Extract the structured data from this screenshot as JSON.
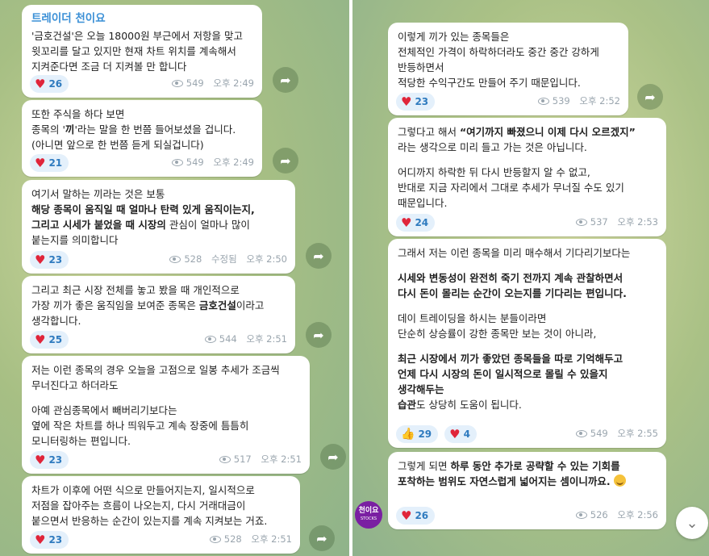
{
  "left": {
    "messages": [
      {
        "sender": "트레이더 천이요",
        "lines": [
          "'금호건설'은 오늘 18000원 부근에서 저항을 맞고",
          "윗꼬리를 달고 있지만 현재 차트 위치를 계속해서",
          "지켜준다면 조금 더 지켜볼 만 합니다"
        ],
        "reaction": "26",
        "views": "549",
        "time": "오후 2:49"
      },
      {
        "l1": "또한 주식을 하다 보면",
        "l2a": "종목의 '",
        "l2b": "끼",
        "l2c": "'라는 말을 한 번쯤 들어보셨을 겁니다.",
        "l3": "(아니면 앞으로 한 번쯤 듣게 되실겁니다)",
        "reaction": "21",
        "views": "549",
        "time": "오후 2:49"
      },
      {
        "l1": "여기서 말하는 끼라는 것은 보통",
        "b1": "해당 종목이 움직일 때 얼마나 탄력 있게 움직이는지,",
        "b2": "그리고 시세가 붙었을 때 시장의",
        "t2": " 관심이 얼마나 많이",
        "l4": "붙는지를 의미합니다",
        "reaction": "23",
        "views": "528",
        "edited": "수정됨",
        "time": "오후 2:50"
      },
      {
        "l1": "그리고 최근 시장 전체를 놓고 봤을 때 개인적으로",
        "l2a": "가장 끼가 좋은 움직임을 보여준 종목은 ",
        "l2b": "금호건설",
        "l2c": "이라고",
        "l3": "생각합니다.",
        "reaction": "25",
        "views": "544",
        "time": "오후 2:51"
      },
      {
        "p1": [
          "저는 이런 종목의 경우 오늘을 고점으로 일봉 추세가 조금씩",
          "무너진다고 하더라도"
        ],
        "p2": [
          "아예 관심종목에서 빼버리기보다는",
          "옆에 작은 차트를 하나 띄워두고 계속 장중에 틈틈히",
          "모니터링하는 편입니다."
        ],
        "reaction": "23",
        "views": "517",
        "time": "오후 2:51"
      },
      {
        "lines": [
          "차트가 이후에 어떤 식으로 만들어지는지, 일시적으로",
          "저점을 잡아주는 흐름이 나오는지, 다시 거래대금이",
          "붙으면서 반응하는 순간이 있는지를 계속 지켜보는 거죠."
        ],
        "reaction": "23",
        "views": "528",
        "time": "오후 2:51"
      }
    ]
  },
  "right": {
    "messages": [
      {
        "lines": [
          "이렇게 끼가 있는 종목들은",
          "전체적인 가격이 하락하더라도 중간 중간 강하게",
          "반등하면서",
          "적당한 수익구간도 만들어 주기 때문입니다."
        ],
        "reaction": "23",
        "views": "539",
        "time": "오후 2:52"
      },
      {
        "l1a": "그렇다고 해서 ",
        "l1b": "“여기까지 빠졌으니 이제 다시 오르겠지”",
        "l2": "라는 생각으로 미리 들고 가는 것은 아닙니다.",
        "p2": [
          "어디까지 하락한 뒤 다시 반등할지 알 수 없고,",
          "반대로 지금 자리에서 그대로 추세가 무너질 수도 있기",
          "때문입니다."
        ],
        "reaction": "24",
        "views": "537",
        "time": "오후 2:53"
      },
      {
        "l1": "그래서 저는 이런 종목을 미리 매수해서 기다리기보다는",
        "b1": [
          "시세와 변동성이 완전히 죽기 전까지 계속 관찰하면서",
          "다시 돈이 몰리는 순간이 오는지를 기다리는 편입니다."
        ],
        "p3": [
          "데이 트레이딩을 하시는 분들이라면",
          "단순히 상승률이 강한 종목만 보는 것이 아니라,"
        ],
        "b4": [
          "최근 시장에서 끼가 좋았던 종목들을 따로 기억해두고",
          "언제 다시 시장의 돈이 일시적으로 몰릴 수 있을지",
          "생각해두는",
          "습관"
        ],
        "t4": "도 상당히 도움이 됩니다.",
        "reaction_thumb": "29",
        "reaction": "4",
        "views": "549",
        "time": "오후 2:55"
      },
      {
        "l1a": "그렇게 되면 ",
        "l1b": "하루 동안 추가로 공략할 수 있는 기회를",
        "l2": "포착하는 범위도 자연스럽게 넓어지는 셈이니까요.",
        "reaction": "26",
        "views": "526",
        "time": "오후 2:56"
      }
    ],
    "avatar_label": "천이요",
    "avatar_sub": "STOCKS"
  },
  "icons": {
    "forward": "forward-arrow-icon",
    "views": "eye-icon",
    "reaction": "heart-icon",
    "scroll": "chevron-down-icon"
  }
}
